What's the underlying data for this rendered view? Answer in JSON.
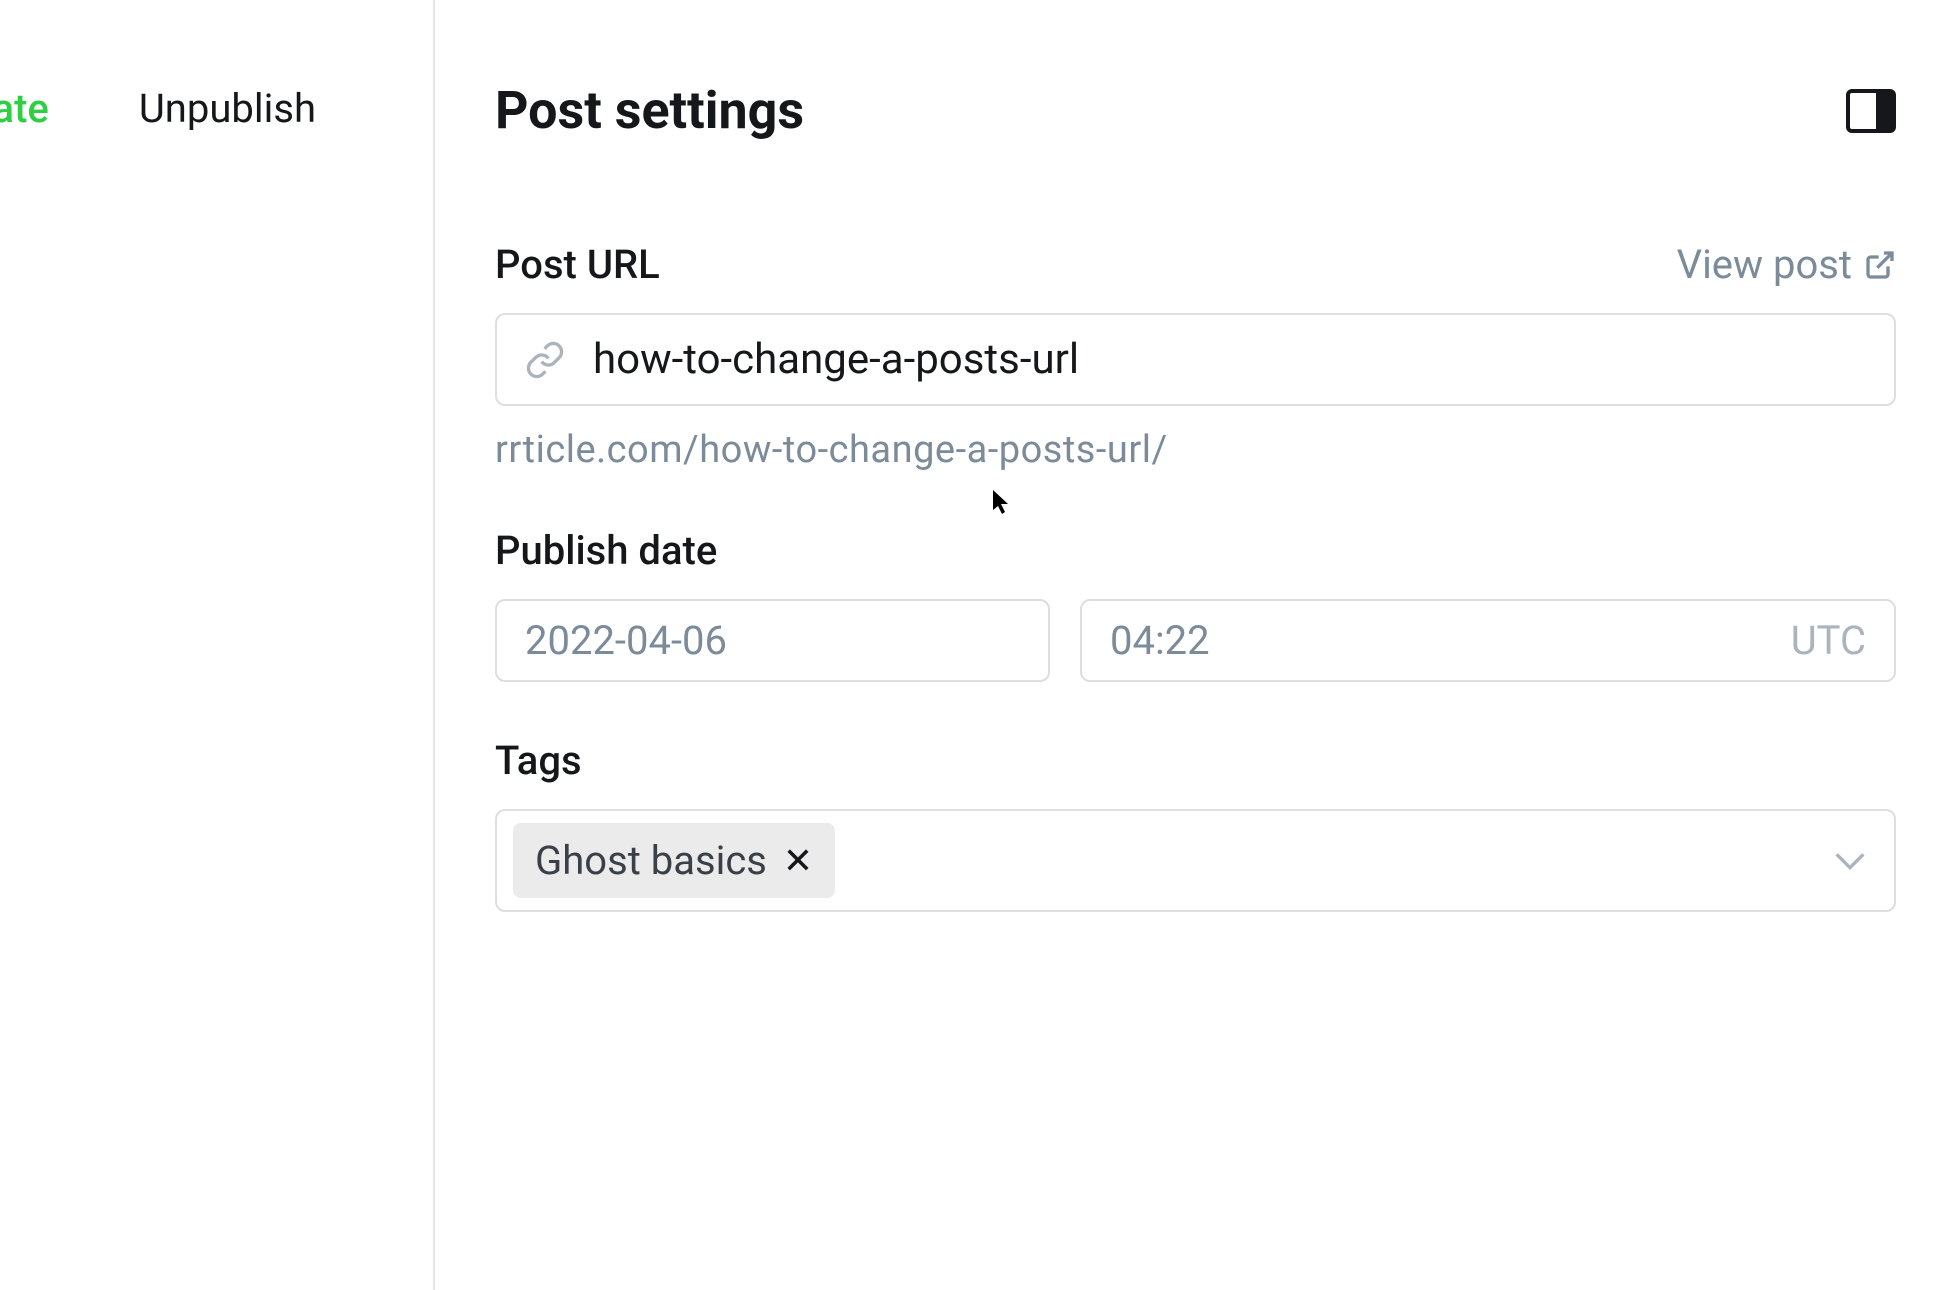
{
  "left_panel": {
    "update_label": "date",
    "unpublish_label": "Unpublish"
  },
  "settings": {
    "title": "Post settings",
    "post_url": {
      "label": "Post URL",
      "view_link": "View post",
      "value": "how-to-change-a-posts-url",
      "preview": "rrticle.com/how-to-change-a-posts-url/"
    },
    "publish_date": {
      "label": "Publish date",
      "date": "2022-04-06",
      "time": "04:22",
      "timezone": "UTC"
    },
    "tags": {
      "label": "Tags",
      "items": [
        {
          "name": "Ghost basics"
        }
      ]
    }
  }
}
